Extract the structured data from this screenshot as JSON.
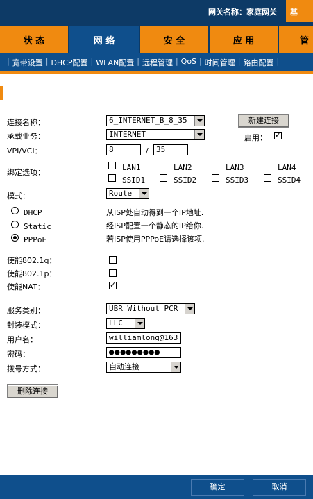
{
  "header": {
    "gateway_label": "网关名称：家庭网关",
    "right_tab_partial": "基"
  },
  "nav": {
    "tabs": [
      {
        "label": "状 态"
      },
      {
        "label": "网 络"
      },
      {
        "label": "安 全"
      },
      {
        "label": "应 用"
      },
      {
        "label": "管"
      }
    ],
    "active_index": 1
  },
  "subnav": {
    "items": [
      "宽带设置",
      "DHCP配置",
      "WLAN配置",
      "远程管理",
      "QoS",
      "时间管理",
      "路由配置"
    ]
  },
  "form": {
    "connection_name": {
      "label": "连接名称：",
      "value": "6_INTERNET_B_8_35"
    },
    "new_connection_button": "新建连接",
    "service": {
      "label": "承载业务：",
      "value": "INTERNET"
    },
    "enable": {
      "label": "启用：",
      "checked": true
    },
    "vpi_vci": {
      "label": "VPI/VCI：",
      "vpi": "8",
      "separator": "/",
      "vci": "35"
    },
    "binding": {
      "label": "绑定选项：",
      "options": [
        "LAN1",
        "LAN2",
        "LAN3",
        "LAN4",
        "SSID1",
        "SSID2",
        "SSID3",
        "SSID4"
      ]
    },
    "mode": {
      "label": "模式：",
      "value": "Route"
    },
    "dhcp": {
      "label": "DHCP",
      "desc": "从ISP处自动得到一个IP地址."
    },
    "static": {
      "label": "Static",
      "desc": "经ISP配置一个静态的IP给你."
    },
    "pppoe": {
      "label": "PPPoE",
      "desc": "若ISP使用PPPoE请选择该项.",
      "selected": true
    },
    "enable_8021q": {
      "label": "使能802.1q：",
      "checked": false
    },
    "enable_8021p": {
      "label": "使能802.1p：",
      "checked": false
    },
    "enable_nat": {
      "label": "使能NAT：",
      "checked": true
    },
    "service_type": {
      "label": "服务类别：",
      "value": "UBR Without PCR"
    },
    "encap": {
      "label": "封装模式：",
      "value": "LLC"
    },
    "username": {
      "label": "用户名：",
      "value": "williamlong@163."
    },
    "password": {
      "label": "密码：",
      "value": "●●●●●●●●●"
    },
    "dial_mode": {
      "label": "拨号方式：",
      "value": "自动连接"
    },
    "delete_button": "删除连接"
  },
  "footer": {
    "confirm": "确定",
    "cancel": "取消"
  }
}
